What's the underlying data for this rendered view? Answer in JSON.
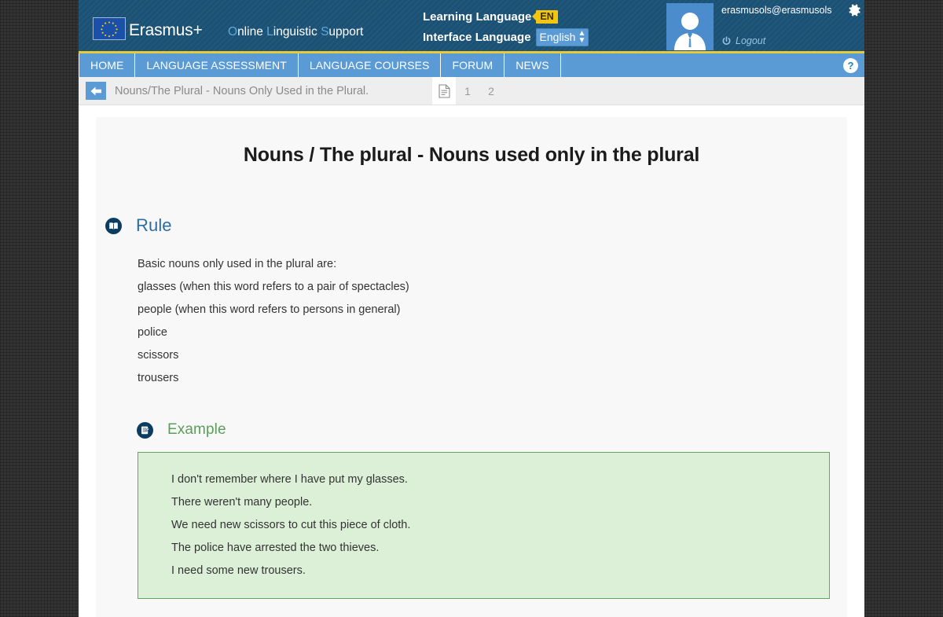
{
  "header": {
    "brand": "Erasmus+",
    "subtitle_parts": [
      {
        "cap": "O",
        "rest": "nline "
      },
      {
        "cap": "L",
        "rest": "inguistic "
      },
      {
        "cap": "S",
        "rest": "upport"
      }
    ],
    "subtitle": "Online Linguistic Support",
    "learning_language_label": "Learning Language",
    "learning_language_value": "EN",
    "interface_language_label": "Interface Language",
    "interface_language_value": "English",
    "user_email": "erasmusols@erasmusols",
    "logout_label": "Logout",
    "colors": {
      "header_bg": "#1a5175",
      "accent_gold": "#e8c938",
      "nav_blue": "#5b9bd5",
      "badge_yellow": "#f2c511"
    }
  },
  "nav": {
    "items": [
      {
        "label": "HOME",
        "name": "nav-item-home"
      },
      {
        "label": "LANGUAGE ASSESSMENT",
        "name": "nav-item-language-assessment"
      },
      {
        "label": "LANGUAGE COURSES",
        "name": "nav-item-language-courses"
      },
      {
        "label": "FORUM",
        "name": "nav-item-forum"
      },
      {
        "label": "NEWS",
        "name": "nav-item-news"
      }
    ],
    "help_label": "?"
  },
  "breadcrumb": {
    "text": "Nouns/The Plural - Nouns Only Used in the Plural.",
    "pages": [
      "1",
      "2"
    ]
  },
  "main": {
    "title": "Nouns / The plural - Nouns used only in the plural",
    "rule": {
      "heading": "Rule",
      "lines": [
        "Basic nouns only used in the plural are:",
        "glasses (when this word refers to a pair of spectacles)",
        "people (when this word refers to persons in general)",
        "police",
        "scissors",
        "trousers"
      ]
    },
    "example": {
      "heading": "Example",
      "lines": [
        "I don't remember where I have put my glasses.",
        "There weren't many people.",
        "We need new scissors to cut this piece of cloth.",
        "The police have arrested the two thieves.",
        "I need some new trousers."
      ],
      "box_bg": "#dcf0d8",
      "box_border": "#62a862"
    }
  }
}
